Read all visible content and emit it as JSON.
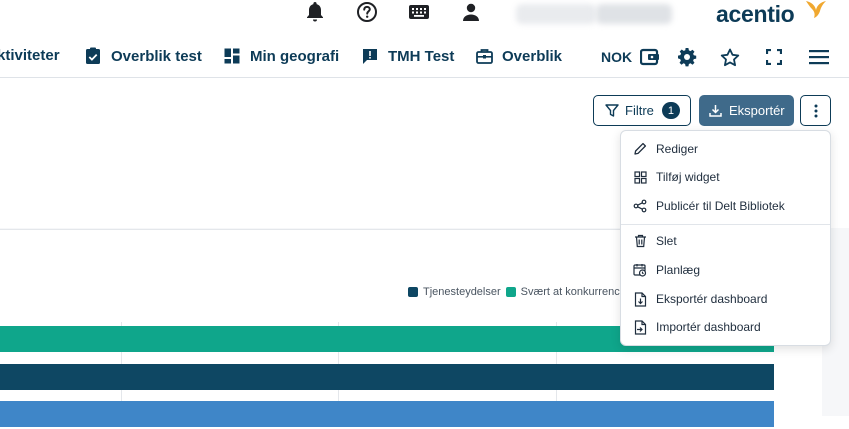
{
  "brand": {
    "name": "acentio"
  },
  "nav": {
    "items": [
      {
        "label": "ktiviteter",
        "icon": "none"
      },
      {
        "label": "Overblik test",
        "icon": "clipboard-check-icon"
      },
      {
        "label": "Min geografi",
        "icon": "dashboard-grid-icon"
      },
      {
        "label": "TMH Test",
        "icon": "comment-alert-icon"
      },
      {
        "label": "Overblik",
        "icon": "briefcase-icon"
      }
    ],
    "currency": "NOK"
  },
  "toolbar": {
    "filter_label": "Filtre",
    "filter_count": "1",
    "export_label": "Eksportér"
  },
  "menu": {
    "items": [
      {
        "label": "Rediger",
        "icon": "pencil-icon"
      },
      {
        "label": "Tilføj widget",
        "icon": "widget-grid-icon"
      },
      {
        "label": "Publicér til Delt Bibliotek",
        "icon": "share-icon"
      },
      {
        "label": "Slet",
        "icon": "trash-icon"
      },
      {
        "label": "Planlæg",
        "icon": "calendar-clock-icon"
      },
      {
        "label": "Eksportér dashboard",
        "icon": "file-export-icon"
      },
      {
        "label": "Importér dashboard",
        "icon": "file-import-icon"
      }
    ]
  },
  "chart": {
    "legend": [
      {
        "label": "Tjenesteydelser",
        "color": "#0e4763"
      },
      {
        "label": "Svært at konkurrence",
        "color": "#0fa68b"
      }
    ],
    "bar_colors": [
      "#0fa68b",
      "#0e4763",
      "#3f86c8"
    ]
  },
  "colors": {
    "primary": "#0d3b57",
    "accent": "#f0a830",
    "export_button": "#3f6a8a"
  }
}
